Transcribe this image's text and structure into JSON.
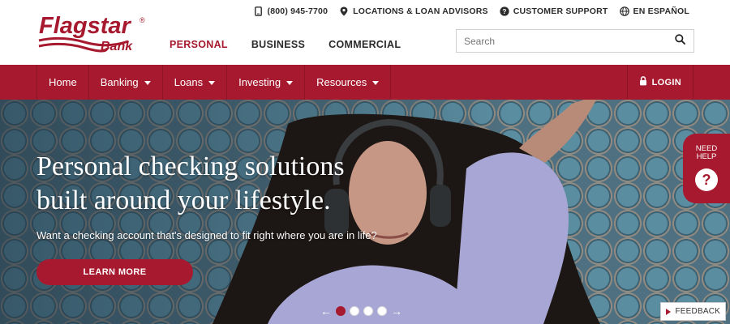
{
  "brand": {
    "name_line1": "Flagstar",
    "name_line2": "Bank",
    "registered": "®",
    "color": "#a6192e"
  },
  "utility_links": [
    {
      "label": "(800) 945-7700",
      "icon": "phone-icon"
    },
    {
      "label": "LOCATIONS & LOAN ADVISORS",
      "icon": "location-pin-icon"
    },
    {
      "label": "CUSTOMER SUPPORT",
      "icon": "help-circle-icon"
    },
    {
      "label": "EN ESPAÑOL",
      "icon": "globe-icon"
    }
  ],
  "segments": [
    {
      "label": "PERSONAL",
      "active": true
    },
    {
      "label": "BUSINESS",
      "active": false
    },
    {
      "label": "COMMERCIAL",
      "active": false
    }
  ],
  "search": {
    "placeholder": "Search",
    "value": "",
    "icon": "search-icon"
  },
  "nav": {
    "items": [
      {
        "label": "Home",
        "has_menu": false
      },
      {
        "label": "Banking",
        "has_menu": true
      },
      {
        "label": "Loans",
        "has_menu": true
      },
      {
        "label": "Investing",
        "has_menu": true
      },
      {
        "label": "Resources",
        "has_menu": true
      }
    ],
    "login_label": "LOGIN",
    "login_icon": "lock-icon"
  },
  "hero": {
    "headline_line1": "Personal checking solutions",
    "headline_line2": "built around your lifestyle.",
    "subtext": "Want a checking account that's designed to fit right where you are in life?",
    "cta_label": "LEARN MORE",
    "slides_total": 4,
    "active_slide": 1
  },
  "need_help": {
    "line1": "NEED",
    "line2": "HELP",
    "symbol": "?"
  },
  "feedback": {
    "label": "FEEDBACK"
  }
}
